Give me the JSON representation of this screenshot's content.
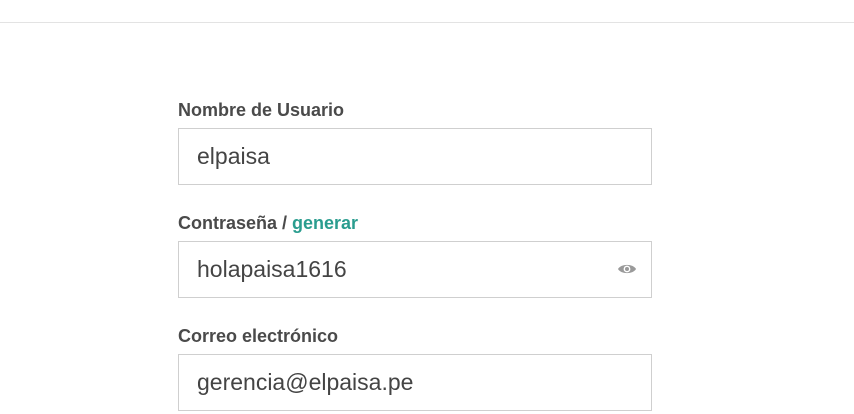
{
  "header": {
    "cut_off_text": "··· ·· ···"
  },
  "form": {
    "username": {
      "label": "Nombre de Usuario",
      "value": "elpaisa"
    },
    "password": {
      "label": "Contraseña / ",
      "generate_link": "generar",
      "value": "holapaisa1616",
      "toggle_icon": "eye-icon"
    },
    "email": {
      "label": "Correo electrónico",
      "value": "gerencia@elpaisa.pe"
    }
  },
  "colors": {
    "link": "#2a9d8f",
    "label": "#4a4a4a",
    "border": "#cfcfcf",
    "icon": "#9a9a9a"
  }
}
